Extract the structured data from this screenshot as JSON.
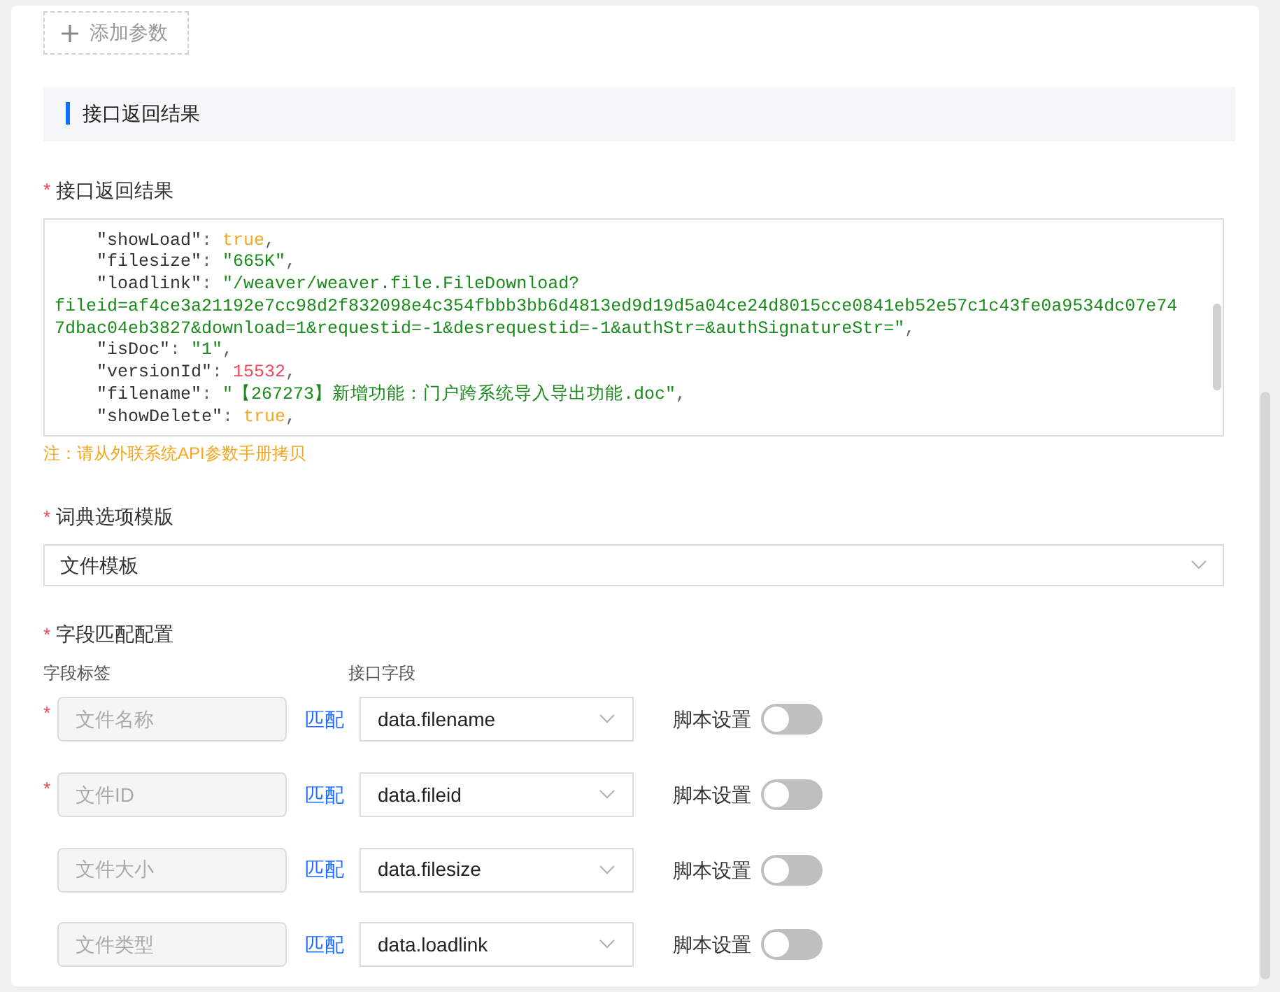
{
  "add_param_button": "添加参数",
  "section_title": "接口返回结果",
  "result_field": {
    "label": "接口返回结果",
    "required": "*",
    "lines": [
      {
        "indent": true,
        "tokens": [
          {
            "kind": "key",
            "text": "\"showLoad\""
          },
          {
            "kind": "punct",
            "text": ": "
          },
          {
            "kind": "bool",
            "text": "true"
          },
          {
            "kind": "punct",
            "text": ","
          }
        ]
      },
      {
        "indent": true,
        "tokens": [
          {
            "kind": "key",
            "text": "\"filesize\""
          },
          {
            "kind": "punct",
            "text": ": "
          },
          {
            "kind": "string",
            "text": "\"665K\""
          },
          {
            "kind": "punct",
            "text": ","
          }
        ]
      },
      {
        "indent": true,
        "tokens": [
          {
            "kind": "key",
            "text": "\"loadlink\""
          },
          {
            "kind": "punct",
            "text": ": "
          },
          {
            "kind": "string",
            "text": "\"/weaver/weaver.file.FileDownload?"
          }
        ]
      },
      {
        "indent": false,
        "tokens": [
          {
            "kind": "string",
            "text": "fileid=af4ce3a21192e7cc98d2f832098e4c354fbbb3bb6d4813ed9d19d5a04ce24d8015cce0841eb52e57c1c43fe0a9534dc07e74"
          }
        ]
      },
      {
        "indent": false,
        "tokens": [
          {
            "kind": "string",
            "text": "7dbac04eb3827&download=1&requestid=-1&desrequestid=-1&authStr=&authSignatureStr=\""
          },
          {
            "kind": "punct",
            "text": ","
          }
        ]
      },
      {
        "indent": true,
        "tokens": [
          {
            "kind": "key",
            "text": "\"isDoc\""
          },
          {
            "kind": "punct",
            "text": ": "
          },
          {
            "kind": "string",
            "text": "\"1\""
          },
          {
            "kind": "punct",
            "text": ","
          }
        ]
      },
      {
        "indent": true,
        "tokens": [
          {
            "kind": "key",
            "text": "\"versionId\""
          },
          {
            "kind": "punct",
            "text": ": "
          },
          {
            "kind": "number",
            "text": "15532"
          },
          {
            "kind": "punct",
            "text": ","
          }
        ]
      },
      {
        "indent": true,
        "tokens": [
          {
            "kind": "key",
            "text": "\"filename\""
          },
          {
            "kind": "punct",
            "text": ": "
          },
          {
            "kind": "string",
            "text": "\"【267273】新增功能：门户跨系统导入导出功能.doc\""
          },
          {
            "kind": "punct",
            "text": ","
          }
        ]
      },
      {
        "indent": true,
        "tokens": [
          {
            "kind": "key",
            "text": "\"showDelete\""
          },
          {
            "kind": "punct",
            "text": ": "
          },
          {
            "kind": "bool",
            "text": "true"
          },
          {
            "kind": "punct",
            "text": ","
          }
        ]
      }
    ],
    "note": "注：请从外联系统API参数手册拷贝"
  },
  "dictionary_template": {
    "label": "词典选项模版",
    "required": "*",
    "value": "文件模板"
  },
  "field_mapping": {
    "label": "字段匹配配置",
    "required": "*",
    "columns": [
      "字段标签",
      "接口字段"
    ],
    "rows": [
      {
        "label": "文件名称",
        "required": "*",
        "match": "匹配",
        "field": "data.filename",
        "script_label": "脚本设置",
        "script_on": false
      },
      {
        "label": "文件ID",
        "required": "*",
        "match": "匹配",
        "field": "data.fileid",
        "script_label": "脚本设置",
        "script_on": false
      },
      {
        "label": "文件大小",
        "match": "匹配",
        "field": "data.filesize",
        "script_label": "脚本设置",
        "script_on": false
      },
      {
        "label": "文件类型",
        "match": "匹配",
        "field": "data.loadlink",
        "script_label": "脚本设置",
        "script_on": false
      }
    ]
  }
}
